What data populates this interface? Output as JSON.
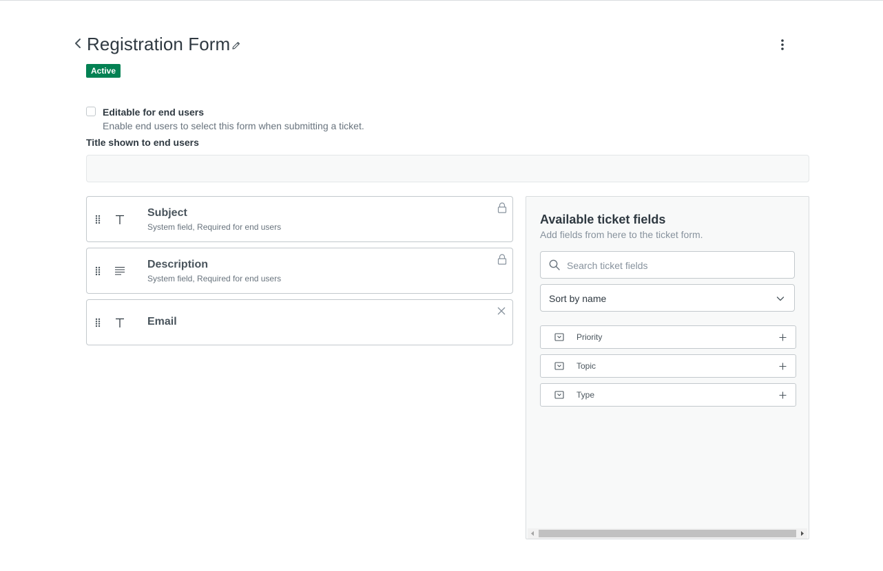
{
  "header": {
    "title": "Registration Form",
    "status_badge": "Active"
  },
  "settings": {
    "editable_label": "Editable for end users",
    "editable_hint": "Enable end users to select this form when submitting a ticket.",
    "editable_checked": false,
    "title_label": "Title shown to end users",
    "title_value": ""
  },
  "form_fields": [
    {
      "name": "Subject",
      "subtitle": "System field, Required for end users",
      "icon": "text-icon",
      "action": "lock-icon"
    },
    {
      "name": "Description",
      "subtitle": "System field, Required for end users",
      "icon": "multiline-text-icon",
      "action": "lock-icon"
    },
    {
      "name": "Email",
      "subtitle": "",
      "icon": "text-icon",
      "action": "close-icon"
    }
  ],
  "panel": {
    "title": "Available ticket fields",
    "subtitle": "Add fields from here to the ticket form.",
    "search_placeholder": "Search ticket fields",
    "sort_value": "Sort by name",
    "fields": [
      {
        "label": "Priority",
        "icon": "dropdown-field-icon"
      },
      {
        "label": "Topic",
        "icon": "dropdown-field-icon"
      },
      {
        "label": "Type",
        "icon": "dropdown-field-icon"
      }
    ]
  },
  "colors": {
    "badge_bg": "#038153",
    "text": "#2f3941",
    "muted": "#68737d",
    "border": "#c2c8cc",
    "panel_bg": "#f8f9f9"
  }
}
